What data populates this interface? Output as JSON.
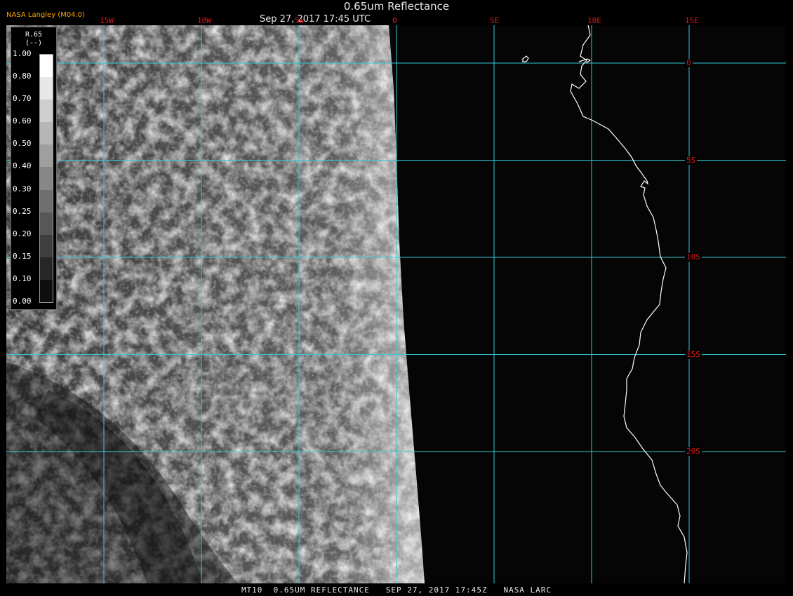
{
  "header": {
    "title": "0.65um Reflectance",
    "time": "Sep 27, 2017 17:45 UTC",
    "source": "NASA Langley (M04.0)"
  },
  "footer": {
    "caption": "MT10  0.65UM REFLECTANCE   SEP 27, 2017 17:45Z   NASA LARC"
  },
  "colorbar": {
    "title": "R.65",
    "unit": "(--)",
    "ticks": [
      "1.00",
      "0.80",
      "0.70",
      "0.60",
      "0.50",
      "0.40",
      "0.30",
      "0.25",
      "0.20",
      "0.15",
      "0.10",
      "0.00"
    ]
  },
  "grid": {
    "longitudes": [
      {
        "label": "15W",
        "value": -15
      },
      {
        "label": "10W",
        "value": -10
      },
      {
        "label": "5W",
        "value": -5
      },
      {
        "label": "0",
        "value": 0
      },
      {
        "label": "5E",
        "value": 5
      },
      {
        "label": "10E",
        "value": 10
      },
      {
        "label": "15E",
        "value": 15
      }
    ],
    "latitudes": [
      {
        "label": "0",
        "value": 0
      },
      {
        "label": "5S",
        "value": -5
      },
      {
        "label": "10S",
        "value": -10
      },
      {
        "label": "15S",
        "value": -15
      },
      {
        "label": "20S",
        "value": -20
      }
    ]
  },
  "colors": {
    "grid": "#36c8d6",
    "grid_label": "#e01818",
    "coastline": "#ffffff",
    "source_label": "#ffa500",
    "background": "#000000"
  }
}
